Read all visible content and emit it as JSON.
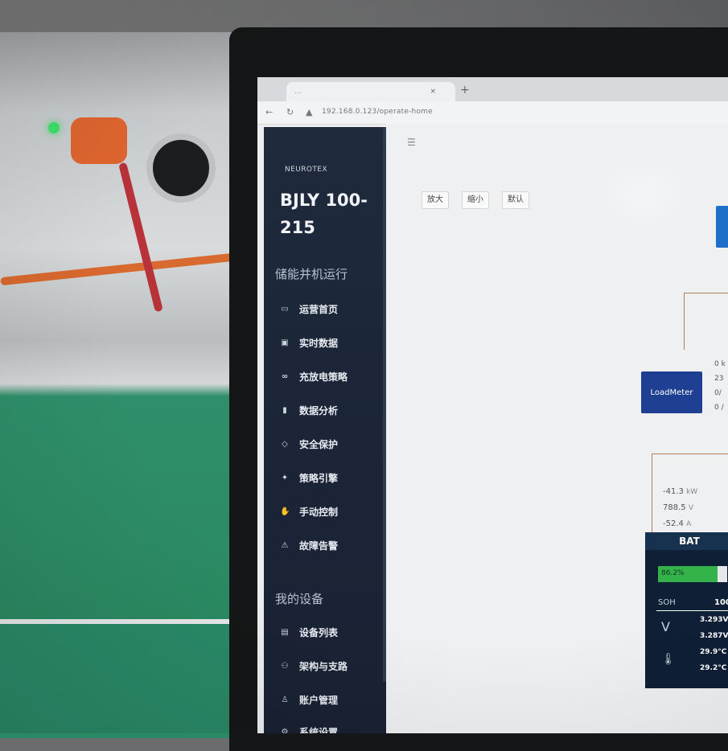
{
  "browser": {
    "tab_title": "...",
    "tab_close": "×",
    "new_tab": "+",
    "url": "192.168.0.123/operate-home"
  },
  "sidebar": {
    "logo_text": "NEUROTEX",
    "brand": "BJLY 100-215",
    "section_run": "储能并机运行",
    "items": [
      {
        "icon": "▭",
        "label": "运营首页"
      },
      {
        "icon": "▣",
        "label": "实时数据"
      },
      {
        "icon": "∞",
        "label": "充放电策略"
      },
      {
        "icon": "▮",
        "label": "数据分析"
      },
      {
        "icon": "◇",
        "label": "安全保护"
      },
      {
        "icon": "✦",
        "label": "策略引擎"
      },
      {
        "icon": "✋",
        "label": "手动控制"
      },
      {
        "icon": "⚠",
        "label": "故障告警"
      }
    ],
    "section_devices": "我的设备",
    "device_items": [
      {
        "icon": "▤",
        "label": "设备列表"
      },
      {
        "icon": "⚇",
        "label": "架构与支路"
      },
      {
        "icon": "♙",
        "label": "账户管理"
      },
      {
        "icon": "⚙",
        "label": "系统设置"
      }
    ]
  },
  "toolbar": {
    "zoom_in": "放大",
    "zoom_out": "缩小",
    "reset": "默认"
  },
  "loadmeter": {
    "label": "LoadMeter",
    "values": [
      "0 k",
      "23",
      "0/",
      "0 /"
    ]
  },
  "measurements": [
    {
      "value": "-41.3",
      "unit": "kW"
    },
    {
      "value": "788.5",
      "unit": "V"
    },
    {
      "value": "-52.4",
      "unit": "A"
    }
  ],
  "battery": {
    "title": "BAT",
    "soc_label": "86.2%",
    "soc_fraction": 0.862,
    "soh_label": "SOH",
    "soh_value": "100",
    "volt_1": "3.293V",
    "volt_2": "3.287V",
    "temp_1": "29.9°C",
    "temp_2": "29.2°C"
  }
}
